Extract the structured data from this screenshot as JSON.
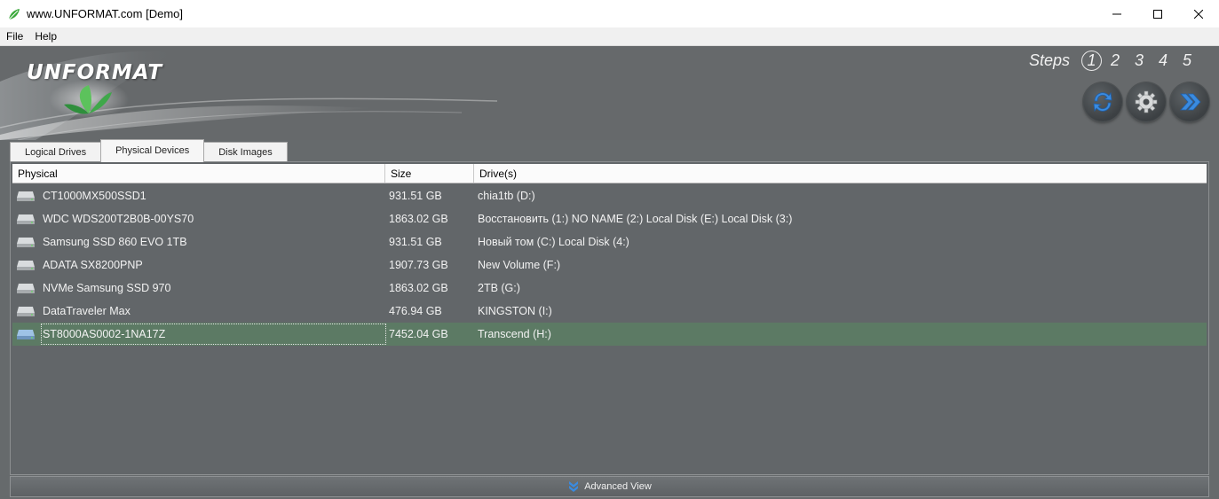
{
  "window": {
    "title": "www.UNFORMAT.com [Demo]"
  },
  "menu": {
    "items": [
      "File",
      "Help"
    ]
  },
  "header": {
    "logo_text": "UNFORMAT",
    "steps_label": "Steps",
    "steps": [
      "1",
      "2",
      "3",
      "4",
      "5"
    ],
    "active_step": "1"
  },
  "tabs": [
    {
      "label": "Logical Drives"
    },
    {
      "label": "Physical Devices",
      "active": true
    },
    {
      "label": "Disk Images"
    }
  ],
  "table": {
    "columns": [
      "Physical",
      "Size",
      "Drive(s)"
    ],
    "rows": [
      {
        "name": "CT1000MX500SSD1",
        "size": "931.51 GB",
        "drives": "chia1tb (D:)"
      },
      {
        "name": "WDC WDS200T2B0B-00YS70",
        "size": "1863.02 GB",
        "drives": "Восстановить (1:) NO NAME (2:) Local Disk (E:) Local Disk (3:)"
      },
      {
        "name": "Samsung SSD 860 EVO 1TB",
        "size": "931.51 GB",
        "drives": "Новый том (C:) Local Disk (4:)"
      },
      {
        "name": "ADATA SX8200PNP",
        "size": "1907.73 GB",
        "drives": "New Volume (F:)"
      },
      {
        "name": "NVMe Samsung SSD 970",
        "size": "1863.02 GB",
        "drives": "2TB (G:)"
      },
      {
        "name": "DataTraveler Max",
        "size": "476.94 GB",
        "drives": "KINGSTON (I:)"
      },
      {
        "name": "ST8000AS0002-1NA17Z",
        "size": "7452.04 GB",
        "drives": "Transcend (H:)",
        "selected": true
      }
    ]
  },
  "footer": {
    "advanced_view_label": "Advanced View"
  },
  "colors": {
    "background": "#666a6c",
    "selected_row": "#5c7a64",
    "action_button": "#3c4043",
    "icon_blue": "#3a8be0"
  }
}
